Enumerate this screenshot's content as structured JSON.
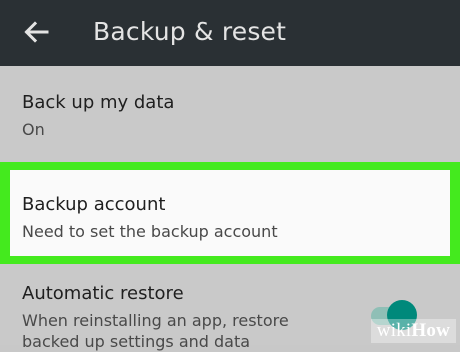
{
  "app_bar": {
    "title": "Backup & reset",
    "back_icon": "arrow-back-icon"
  },
  "preferences": [
    {
      "title": "Back up my data",
      "summary": "On"
    },
    {
      "title": "Backup account",
      "summary": "Need to set the backup account",
      "highlighted": true
    },
    {
      "title": "Automatic restore",
      "summary_lines": [
        "When reinstalling an app, restore",
        "backed up settings and data"
      ],
      "toggle": {
        "state": "on"
      }
    }
  ],
  "watermark": {
    "prefix": "wiki",
    "suffix": "How"
  },
  "colors": {
    "app_bar": "#2a3034",
    "background": "#c9c9c9",
    "highlight_border": "#44ea1e",
    "toggle_on": "#00897b"
  }
}
